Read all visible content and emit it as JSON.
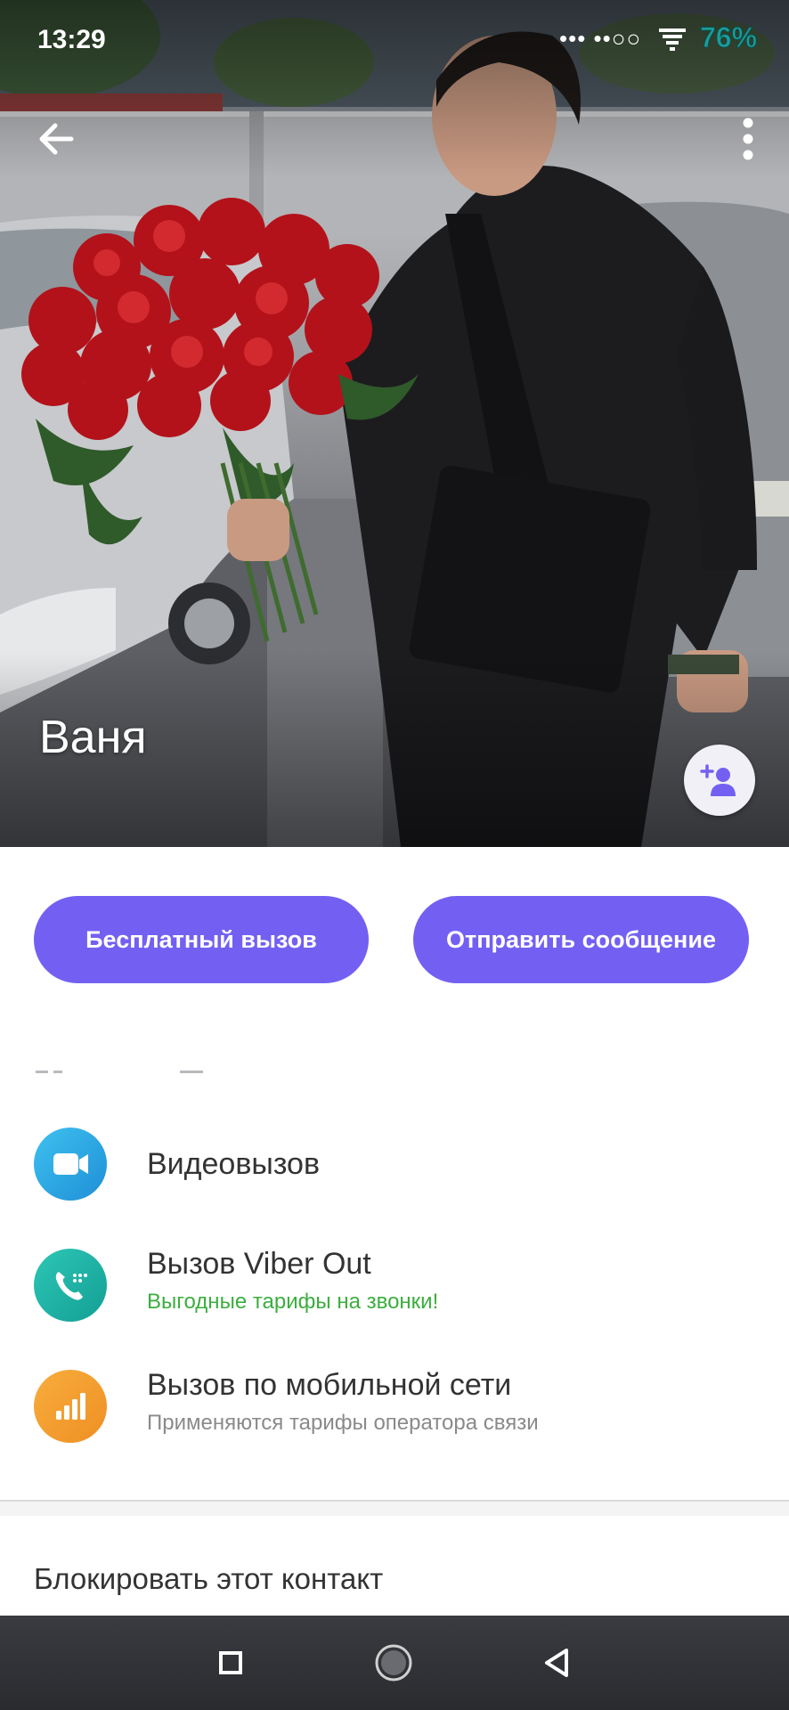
{
  "status_bar": {
    "time": "13:29",
    "indicators": "•••  ••○○",
    "battery": "76%"
  },
  "header": {
    "back_icon": "arrow-left-icon",
    "more_icon": "more-vertical-icon",
    "contact_name": "Ваня",
    "add_contact_icon": "add-person-icon"
  },
  "actions": {
    "free_call_label": "Бесплатный вызов",
    "send_message_label": "Отправить сообщение",
    "accent_color": "#7360f2"
  },
  "call_options": [
    {
      "icon": "video-camera-icon",
      "title": "Видеовызов",
      "subtitle": "",
      "color": "#2aa9e6"
    },
    {
      "icon": "phone-ring-icon",
      "title": "Вызов Viber Out",
      "subtitle": "Выгодные тарифы на звонки!",
      "subtitle_color": "#3cae3f",
      "color": "#1fb5a5"
    },
    {
      "icon": "signal-bars-icon",
      "title": "Вызов по мобильной сети",
      "subtitle": "Применяются тарифы оператора связи",
      "subtitle_color": "#8a8a8a",
      "color": "#f39c2f"
    }
  ],
  "block_contact_label": "Блокировать этот контакт",
  "nav_bar": {
    "recents_icon": "square-icon",
    "home_icon": "circle-icon",
    "back_icon": "triangle-back-icon"
  }
}
